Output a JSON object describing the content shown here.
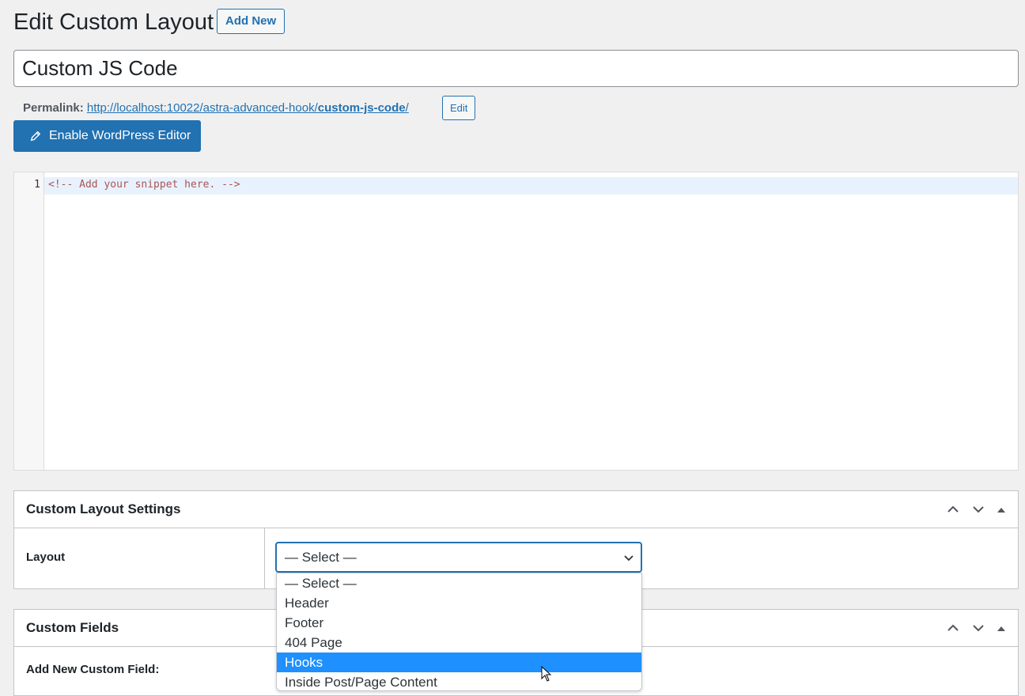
{
  "header": {
    "title": "Edit Custom Layout",
    "add_new_label": "Add New"
  },
  "post_title": {
    "value": "Custom JS Code"
  },
  "permalink": {
    "label": "Permalink:",
    "url_base": "http://localhost:10022/astra-advanced-hook/",
    "url_slug": "custom-js-code",
    "url_trailing": "/",
    "edit_label": "Edit"
  },
  "editor_toggle": {
    "label": "Enable WordPress Editor",
    "icon": "pencil-icon"
  },
  "code_editor": {
    "line_number": "1",
    "code": "<!-- Add your snippet here. -->"
  },
  "layout_settings": {
    "title": "Custom Layout Settings",
    "layout_label": "Layout",
    "selected_value": "— Select —",
    "options": [
      "— Select —",
      "Header",
      "Footer",
      "404 Page",
      "Hooks",
      "Inside Post/Page Content"
    ],
    "highlighted_option": "Hooks"
  },
  "custom_fields": {
    "title": "Custom Fields",
    "add_new_label": "Add New Custom Field:"
  },
  "colors": {
    "accent": "#2271b1",
    "highlight": "#1e90ff"
  }
}
